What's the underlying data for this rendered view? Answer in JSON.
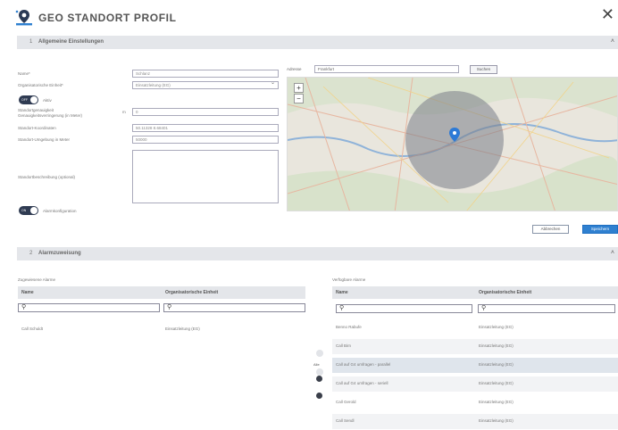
{
  "header": {
    "title": "GEO STANDORT PROFIL",
    "close_glyph": "✕"
  },
  "section1": {
    "number": "1",
    "title": "Allgemeine Einstellungen",
    "chevron": "˄",
    "fields": {
      "name": {
        "label": "Name*",
        "value": "Schlanz"
      },
      "org": {
        "label": "Organisatorische Einheit*",
        "value": "Einsatzleitung (EG)"
      },
      "toggle_active": {
        "state": "OFF",
        "label": "Aktiv"
      },
      "reduction": {
        "label": "Standortgenauigkeit",
        "label2": "Genauigkeitsverringerung (in Meter)",
        "suffix": "m",
        "value": "0"
      },
      "coords": {
        "label": "Standort-Koordinaten",
        "value": "50.11328  8.68401"
      },
      "radius": {
        "label": "Standort-Umgebung in Meter",
        "value": "50000"
      },
      "description": {
        "label": "Standortbeschreibung (optional)",
        "value": ""
      },
      "toggle_alarm": {
        "state": "ON",
        "label": "Alarmkonfiguration"
      }
    },
    "address_search": {
      "label": "Adresse",
      "value": "Frankfurt",
      "button": "Suchen"
    },
    "map": {
      "zoom_in": "+",
      "zoom_out": "−",
      "marker_color": "#2d7ad6",
      "circle_color": "#7a7e88"
    },
    "buttons": {
      "cancel": "Abbrechen",
      "save": "Speichern"
    }
  },
  "section2": {
    "number": "2",
    "title": "Alarmzuweisung",
    "chevron": "˄",
    "left": {
      "caption": "Zugewiesene Alarme",
      "col_name": "Name",
      "col_org": "Organisatorische Einheit",
      "filter_icon": "⚲",
      "rows": [
        {
          "name": "Call Schuldt",
          "org": "Einsatzleitung (EG)"
        }
      ]
    },
    "middle": {
      "add_all": "Alle"
    },
    "right": {
      "caption": "Verfügbare Alarme",
      "col_name": "Name",
      "col_org": "Organisatorische Einheit",
      "filter_icon": "⚲",
      "rows": [
        {
          "name": "Benno Rabufe",
          "org": "Einsatzleitung (EG)"
        },
        {
          "name": "Call Birn",
          "org": "Einsatzleitung (EG)"
        },
        {
          "name": "Call auf G4 umfragen - parallel",
          "org": "Einsatzleitung (EG)"
        },
        {
          "name": "Call auf G4 umfragen - seriell",
          "org": "Einsatzleitung (EG)"
        },
        {
          "name": "Call Gerold",
          "org": "Einsatzleitung (EG)"
        },
        {
          "name": "Call Sendl",
          "org": "Einsatzleitung (EG)"
        }
      ]
    }
  },
  "colors": {
    "accent": "#2f80d0",
    "section_bar": "#e4e6ea",
    "toggle": "#2f3b52"
  }
}
